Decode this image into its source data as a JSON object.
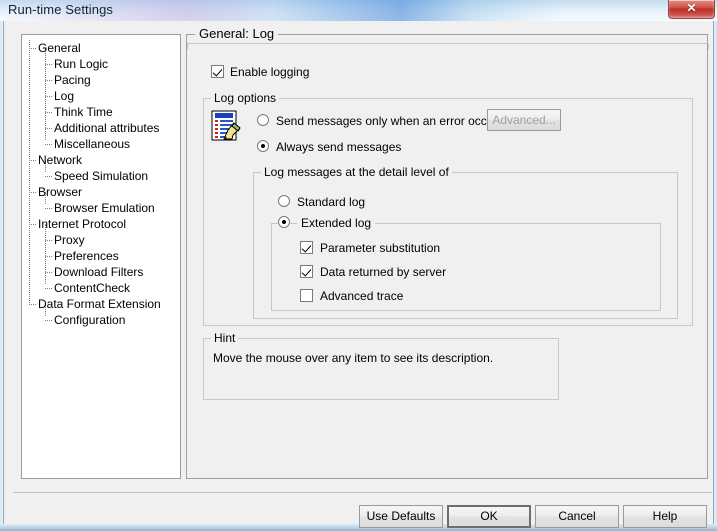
{
  "window": {
    "title": "Run-time Settings",
    "close_label": "✕",
    "close_icon": "close-icon"
  },
  "sidebar": {
    "items": [
      {
        "label": "General",
        "level": 0
      },
      {
        "label": "Run Logic",
        "level": 1
      },
      {
        "label": "Pacing",
        "level": 1
      },
      {
        "label": "Log",
        "level": 1,
        "selected": true
      },
      {
        "label": "Think Time",
        "level": 1
      },
      {
        "label": "Additional attributes",
        "level": 1
      },
      {
        "label": "Miscellaneous",
        "level": 1
      },
      {
        "label": "Network",
        "level": 0
      },
      {
        "label": "Speed Simulation",
        "level": 1
      },
      {
        "label": "Browser",
        "level": 0
      },
      {
        "label": "Browser Emulation",
        "level": 1
      },
      {
        "label": "Internet Protocol",
        "level": 0
      },
      {
        "label": "Proxy",
        "level": 1
      },
      {
        "label": "Preferences",
        "level": 1
      },
      {
        "label": "Download Filters",
        "level": 1
      },
      {
        "label": "ContentCheck",
        "level": 1
      },
      {
        "label": "Data Format Extension",
        "level": 0
      },
      {
        "label": "Configuration",
        "level": 1
      }
    ]
  },
  "main": {
    "page_title": "General: Log",
    "enable_logging": {
      "label": "Enable logging",
      "checked": true
    },
    "log_options": {
      "legend": "Log options",
      "icon": "log-document-pencil-icon",
      "radio_error_only": {
        "label": "Send messages only when an error occurs",
        "selected": false
      },
      "radio_always": {
        "label": "Always send messages",
        "selected": true
      },
      "advanced_button": {
        "label": "Advanced...",
        "disabled": true
      },
      "detail_level": {
        "legend": "Log messages at the detail level of",
        "radio_standard": {
          "label": "Standard log",
          "selected": false
        },
        "radio_extended": {
          "label": "Extended log",
          "selected": true
        },
        "extended_options": [
          {
            "label": "Parameter substitution",
            "checked": true
          },
          {
            "label": "Data returned by server",
            "checked": true
          },
          {
            "label": "Advanced trace",
            "checked": false
          }
        ]
      }
    },
    "hint": {
      "legend": "Hint",
      "text": "Move the mouse over any item to see its description."
    }
  },
  "buttons": {
    "use_defaults": "Use Defaults",
    "ok": "OK",
    "cancel": "Cancel",
    "help": "Help"
  },
  "colors": {
    "dialog_face": "#f0f0f0",
    "panel_white": "#ffffff",
    "group_border": "#c8c8c8",
    "close_red": "#bb2f26",
    "title_text": "#10242e"
  }
}
